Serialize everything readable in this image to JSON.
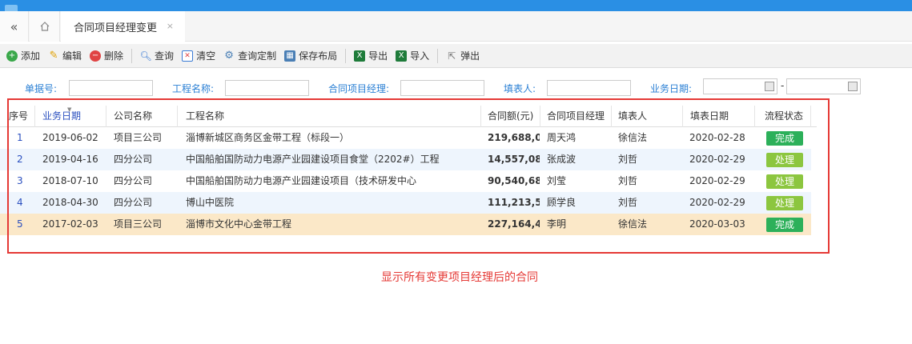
{
  "colors": {
    "brand_blue": "#2a8fe4",
    "label_blue": "#2a7fd4",
    "done_green": "#2cb05a",
    "processing_green": "#8cc63f",
    "highlight_row": "#fbe8c8",
    "alt_row": "#eef5fd",
    "annotation_red": "#e53935"
  },
  "tabs": {
    "back_icon": "double-chevron-left",
    "home_icon": "home",
    "active": "合同项目经理变更",
    "close": "×"
  },
  "toolbar": {
    "add": "添加",
    "edit": "编辑",
    "delete": "删除",
    "search": "查询",
    "clear": "清空",
    "custom_query": "查询定制",
    "save_layout": "保存布局",
    "export": "导出",
    "import": "导入",
    "popup": "弹出"
  },
  "filters": {
    "doc_no": "单据号:",
    "project_name": "工程名称:",
    "contract_pm": "合同项目经理:",
    "filler": "填表人:",
    "biz_date": "业务日期:",
    "range_sep": "-"
  },
  "table": {
    "headers": [
      "序号",
      "业务日期",
      "公司名称",
      "工程名称",
      "合同额(元)",
      "合同项目经理",
      "填表人",
      "填表日期",
      "流程状态"
    ],
    "rows": [
      {
        "no": "1",
        "date": "2019-06-02",
        "company": "项目三公司",
        "project": "淄博新城区商务区金带工程（标段一）",
        "amount": "219,688,0...",
        "pm": "周天鸿",
        "filler": "徐信法",
        "fill_date": "2020-02-28",
        "status": "完成"
      },
      {
        "no": "2",
        "date": "2019-04-16",
        "company": "四分公司",
        "project": "中国船舶国防动力电源产业园建设项目食堂（2202#）工程",
        "amount": "14,557,08...",
        "pm": "张成波",
        "filler": "刘哲",
        "fill_date": "2020-02-29",
        "status": "处理中"
      },
      {
        "no": "3",
        "date": "2018-07-10",
        "company": "四分公司",
        "project": "中国船舶国防动力电源产业园建设项目（技术研发中心",
        "amount": "90,540,68...",
        "pm": "刘莹",
        "filler": "刘哲",
        "fill_date": "2020-02-29",
        "status": "处理中"
      },
      {
        "no": "4",
        "date": "2018-04-30",
        "company": "四分公司",
        "project": "博山中医院",
        "amount": "111,213,57...",
        "pm": "顾学良",
        "filler": "刘哲",
        "fill_date": "2020-02-29",
        "status": "处理中"
      },
      {
        "no": "5",
        "date": "2017-02-03",
        "company": "项目三公司",
        "project": "淄博市文化中心金带工程",
        "amount": "227,164,4...",
        "pm": "李明",
        "filler": "徐信法",
        "fill_date": "2020-03-03",
        "status": "完成"
      }
    ]
  },
  "annotation": "显示所有变更项目经理后的合同"
}
